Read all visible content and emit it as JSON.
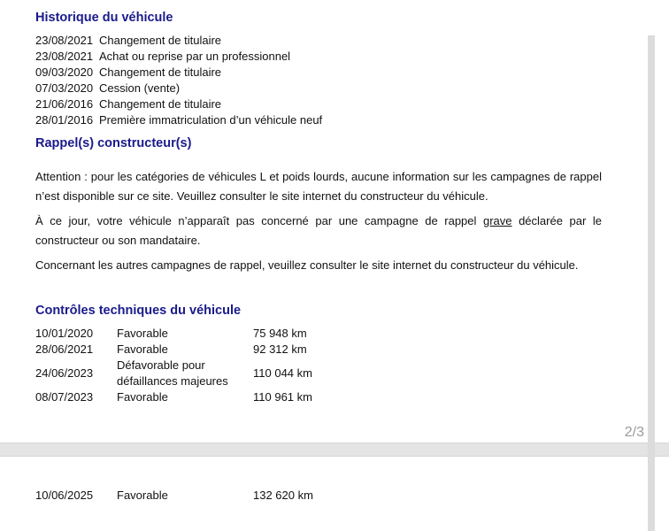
{
  "history": {
    "title": "Historique du véhicule",
    "rows": [
      {
        "date": "23/08/2021",
        "event": "Changement de titulaire"
      },
      {
        "date": "23/08/2021",
        "event": "Achat ou reprise par un professionnel"
      },
      {
        "date": "09/03/2020",
        "event": "Changement de titulaire"
      },
      {
        "date": "07/03/2020",
        "event": "Cession (vente)"
      },
      {
        "date": "21/06/2016",
        "event": "Changement de titulaire"
      },
      {
        "date": "28/01/2016",
        "event": "Première immatriculation d’un véhicule neuf"
      }
    ]
  },
  "recall": {
    "title": "Rappel(s) constructeur(s)",
    "p1": "Attention : pour les catégories de véhicules L et poids lourds, aucune information sur les campagnes de rappel n’est disponible sur ce site. Veuillez consulter le site internet du constructeur du véhicule.",
    "p2_before": "À ce jour, votre véhicule n’apparaît pas concerné par une campagne de rappel ",
    "p2_underlined": "grave",
    "p2_after": " déclarée par le constructeur ou son mandataire.",
    "p3": "Concernant les autres campagnes de rappel, veuillez consulter le site internet du constructeur du véhicule."
  },
  "inspections": {
    "title": "Contrôles techniques du véhicule",
    "rows": [
      {
        "date": "10/01/2020",
        "result": "Favorable",
        "km": "75 948 km"
      },
      {
        "date": "28/06/2021",
        "result": "Favorable",
        "km": "92 312 km"
      },
      {
        "date": "24/06/2023",
        "result": "Défavorable pour défaillances majeures",
        "km": "110 044 km"
      },
      {
        "date": "08/07/2023",
        "result": "Favorable",
        "km": "110 961 km"
      }
    ],
    "next_page_rows": [
      {
        "date": "10/06/2025",
        "result": "Favorable",
        "km": "132 620 km"
      }
    ]
  },
  "viewer": {
    "page_indicator": "2/3"
  }
}
